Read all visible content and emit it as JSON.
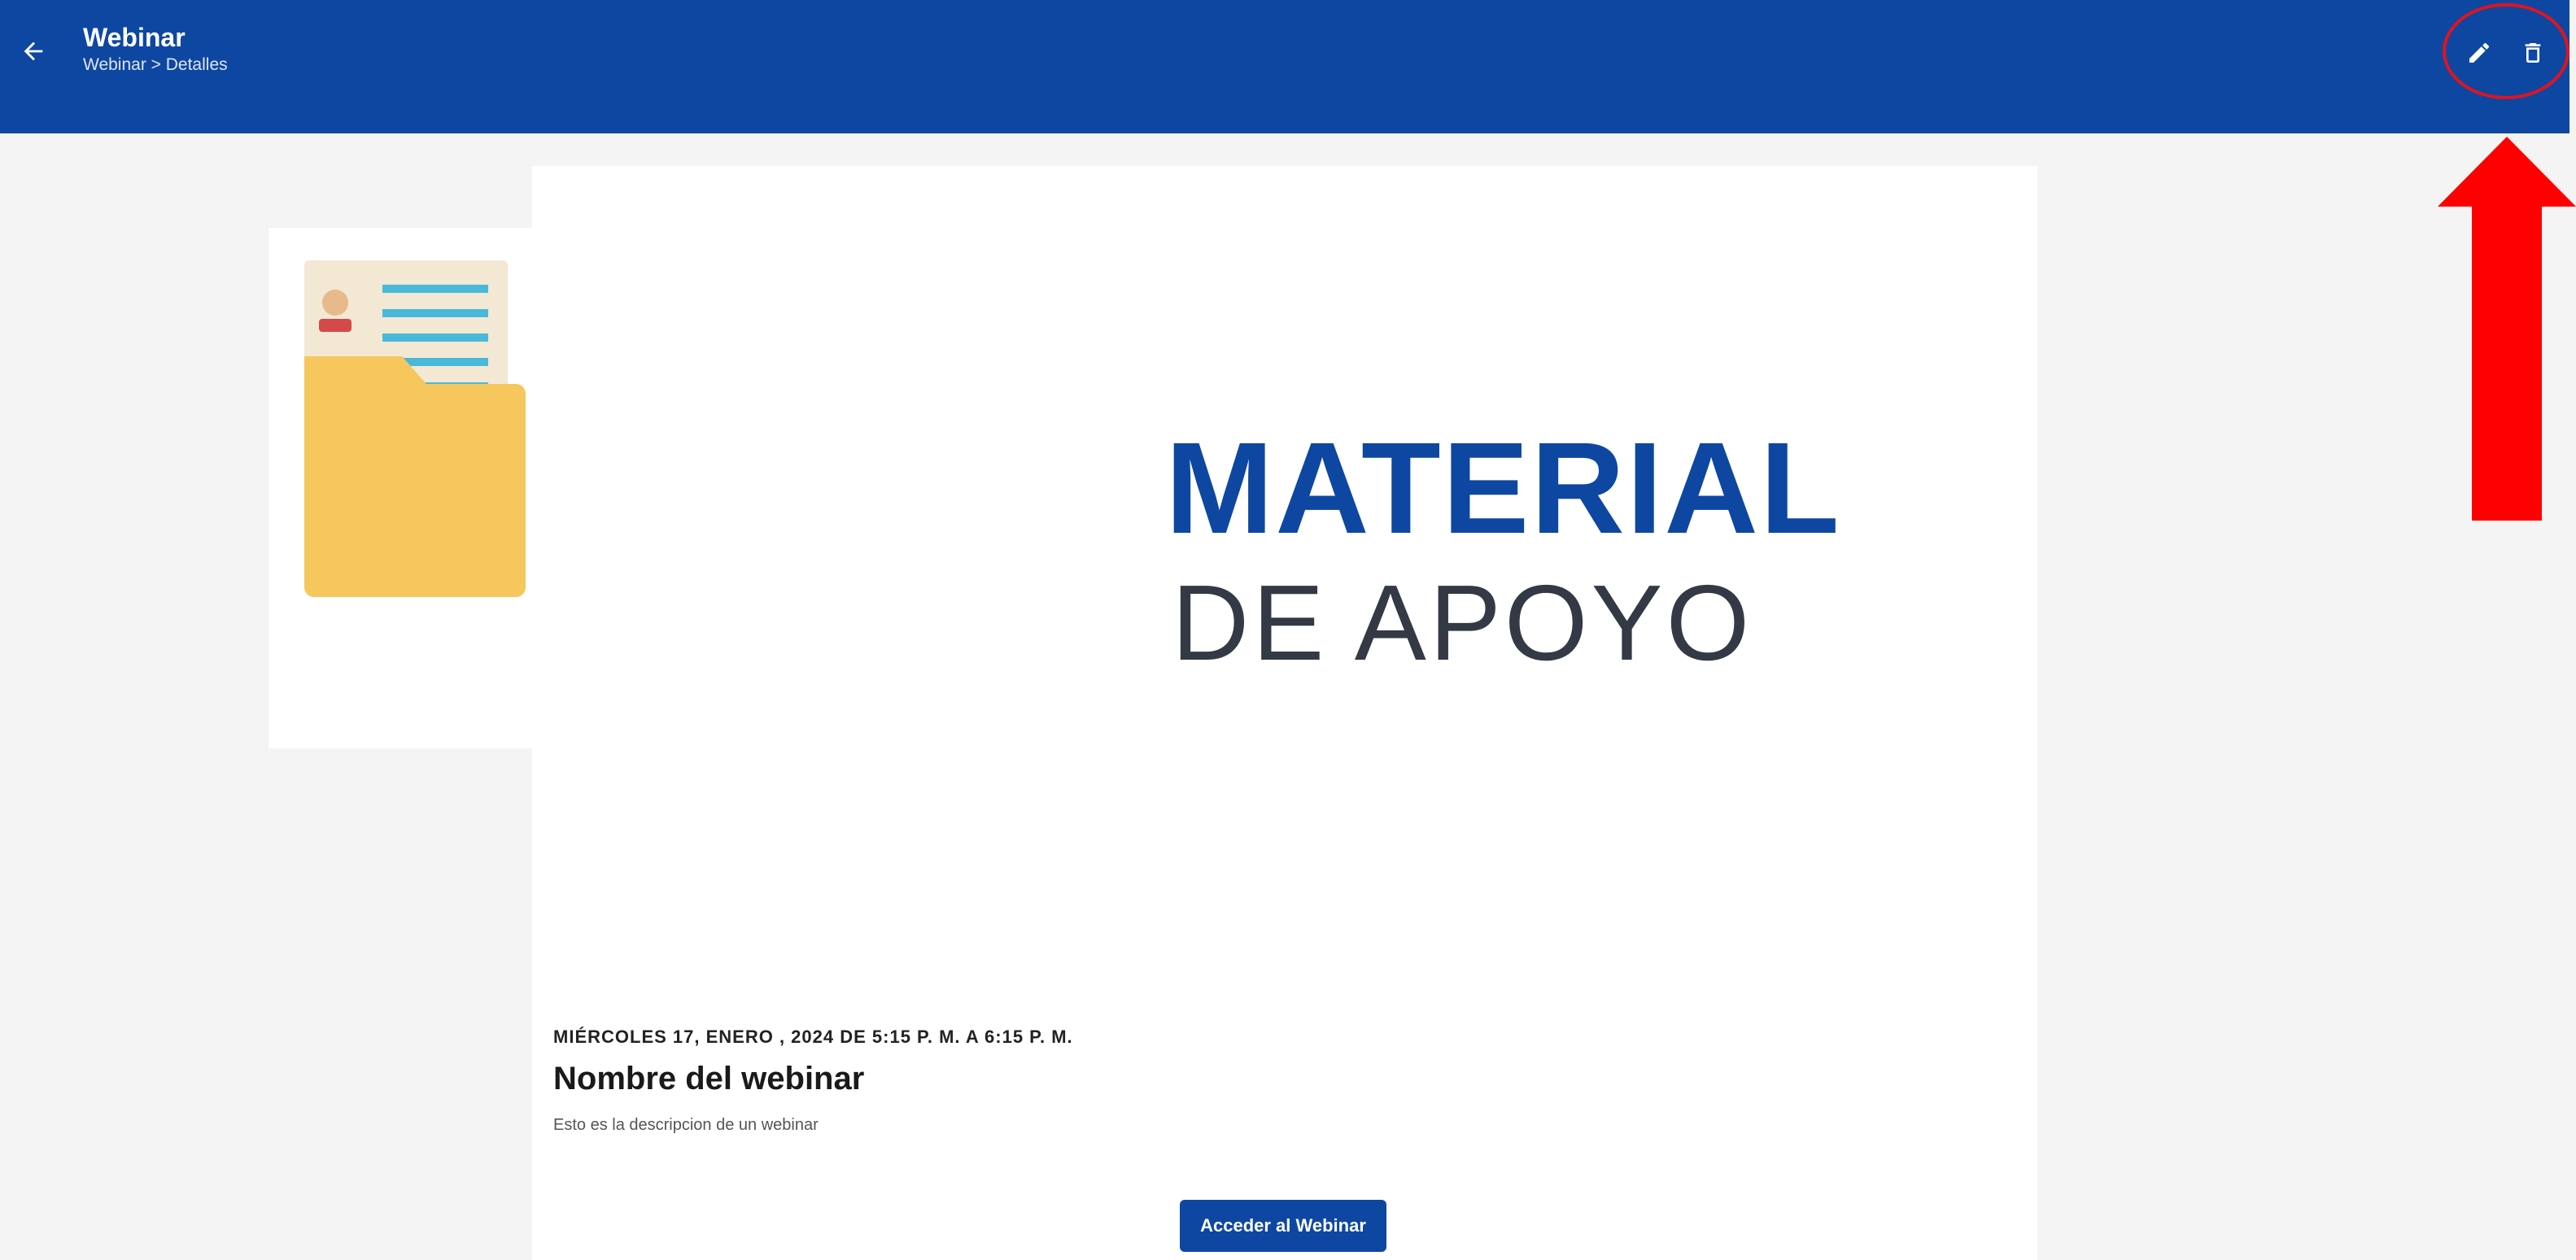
{
  "header": {
    "title": "Webinar",
    "breadcrumb": "Webinar > Detalles",
    "back_icon": "arrow-left-icon",
    "edit_icon": "pencil-icon",
    "delete_icon": "trash-icon"
  },
  "banner": {
    "line1": "MATERIAL",
    "line2": "DE APOYO",
    "illustration": "folder-document-icon"
  },
  "webinar": {
    "datetime": "MIÉRCOLES 17, ENERO , 2024 DE 5:15 P. M. A 6:15 P. M.",
    "name": "Nombre del webinar",
    "description": "Esto es la descripcion de un webinar",
    "join_label": "Acceder al Webinar"
  },
  "colors": {
    "primary": "#0e47a1",
    "background": "#f4f4f4",
    "annotation": "#e0141f",
    "folder": "#f6c75c"
  }
}
